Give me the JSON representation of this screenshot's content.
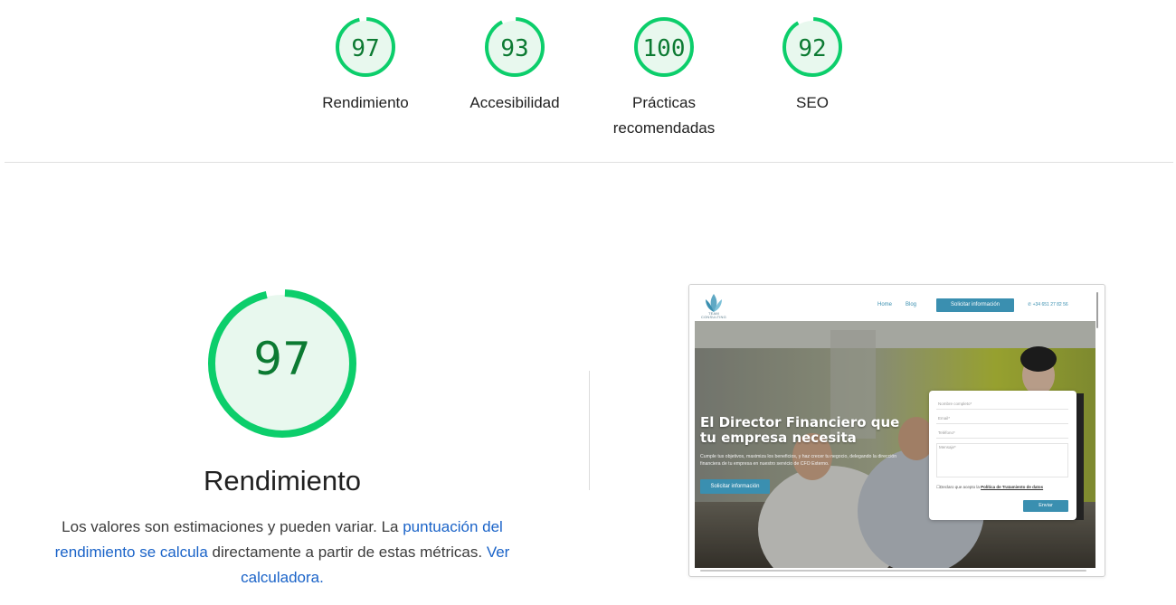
{
  "categories": [
    {
      "score": "97",
      "value": 97,
      "label": "Rendimiento"
    },
    {
      "score": "93",
      "value": 93,
      "label": "Accesibilidad"
    },
    {
      "score": "100",
      "value": 100,
      "label": "Prácticas recomendadas"
    },
    {
      "score": "92",
      "value": 92,
      "label": "SEO"
    }
  ],
  "detail": {
    "score": "97",
    "value": 97,
    "title": "Rendimiento",
    "desc_before": "Los valores son estimaciones y pueden variar. La ",
    "link1": "puntuación del rendimiento se calcula",
    "desc_middle": " directamente a partir de estas métricas. ",
    "link2": "Ver calculadora."
  },
  "colors": {
    "pass": "#0cce6b",
    "pass_fill": "#e8f8ee",
    "pass_text": "#0c7a32",
    "link": "#1a63c8",
    "brand": "#3a8fb0"
  },
  "screenshot": {
    "logo_text": "TEAM CONSULTING",
    "nav": {
      "home": "Home",
      "blog": "Blog",
      "cta": "Solicitar información",
      "phone": "+34 651 27 82 56"
    },
    "hero": {
      "title": "El Director Financiero que tu empresa necesita",
      "subtitle": "Cumple tus objetivos, maximiza los beneficios, y haz crecer tu negocio, delegando la dirección financiera de tu empresa en nuestro servicio de CFO Externo.",
      "cta": "Solicitar información"
    },
    "form": {
      "name": "Nombre completo*",
      "email": "Email*",
      "phone": "Teléfono*",
      "message": "Mensaje*",
      "consent_before": "Declaro que acepto la ",
      "consent_link": "Política de Tratamiento de datos",
      "send": "Enviar"
    }
  }
}
